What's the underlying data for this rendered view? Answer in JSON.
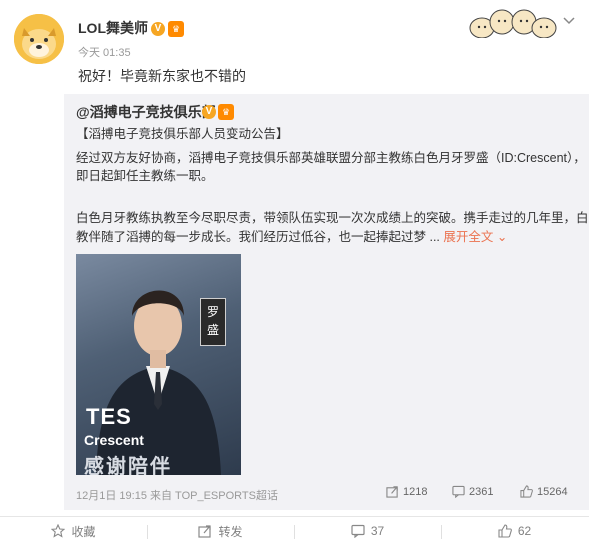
{
  "post": {
    "author": "LOL舞美师",
    "verify_badge": "V",
    "time": "今天 01:35",
    "text": "祝好！毕竟新东家也不错的"
  },
  "repost": {
    "author": "@滔搏电子竞技俱乐部",
    "verify_badge": "V",
    "title": "【滔搏电子竞技俱乐部人员变动公告】",
    "p1_line1": "经过双方友好协商，滔搏电子竞技俱乐部英雄联盟分部主教练白色月牙罗盛（ID:Crescent），",
    "p1_line2": "即日起卸任主教练一职。",
    "p2_line1": "白色月牙教练执教至今尽职尽责，带领队伍实现一次次成绩上的突破。携手走过的几年里，白",
    "p2_line2": "教伴随了滔搏的每一步成长。我们经历过低谷，也一起捧起过梦 ...",
    "expand_label": "展开全文",
    "poster": {
      "name_tag": [
        "罗",
        "盛"
      ],
      "team": "TES",
      "player": "Crescent",
      "thanks": "感谢陪伴"
    },
    "footer": {
      "meta": "12月1日 19:15 来自 TOP_ESPORTS超话",
      "reposts": "1218",
      "comments": "2361",
      "likes": "15264"
    }
  },
  "actions": {
    "favorite": "收藏",
    "forward": "转发",
    "comments": "37",
    "likes": "62"
  },
  "colors": {
    "accent": "#eb7350",
    "verify": "#f6a623",
    "repost_bg": "#f2f2f5"
  }
}
